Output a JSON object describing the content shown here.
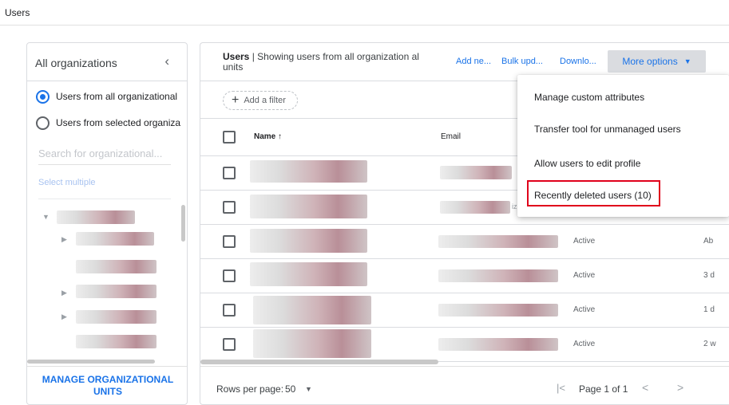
{
  "page": {
    "title": "Users"
  },
  "left_panel": {
    "title": "All organizations",
    "collapse_icon": "chevron-left-icon",
    "radio_all": "Users from all organizational",
    "radio_selected": "Users from selected organiza",
    "search_placeholder": "Search for organizational...",
    "select_multiple": "Select multiple",
    "manage_button_line1": "MANAGE ORGANIZATIONAL",
    "manage_button_line2": "UNITS"
  },
  "main": {
    "title_bold": "Users",
    "title_rest": " | Showing users from all organization al units",
    "actions": {
      "add_new": "Add ne...",
      "bulk_update": "Bulk upd...",
      "download": "Downlo...",
      "more_options": "More options"
    },
    "add_filter": "Add a filter",
    "columns": {
      "name": "Name",
      "sort_icon": "arrow-up-icon",
      "email": "Email"
    },
    "rows": [
      {
        "status": "",
        "last": "",
        "email_suffix": ""
      },
      {
        "status": "",
        "last": "",
        "email_suffix": "iz"
      },
      {
        "status": "Active",
        "last": "Ab"
      },
      {
        "status": "Active",
        "last": "3 d"
      },
      {
        "status": "Active",
        "last": "1 d"
      },
      {
        "status": "Active",
        "last": "2 w"
      }
    ],
    "footer": {
      "rows_per_page_label": "Rows per page:",
      "rows_per_page_value": "50",
      "page_text": "Page 1 of 1"
    }
  },
  "menu": {
    "items": [
      "Manage custom attributes",
      "Transfer tool for unmanaged users",
      "Allow users to edit profile",
      "Recently deleted users (10)"
    ],
    "highlight_color": "#e0001b"
  },
  "colors": {
    "accent": "#1a73e8",
    "border": "#dadce0"
  }
}
